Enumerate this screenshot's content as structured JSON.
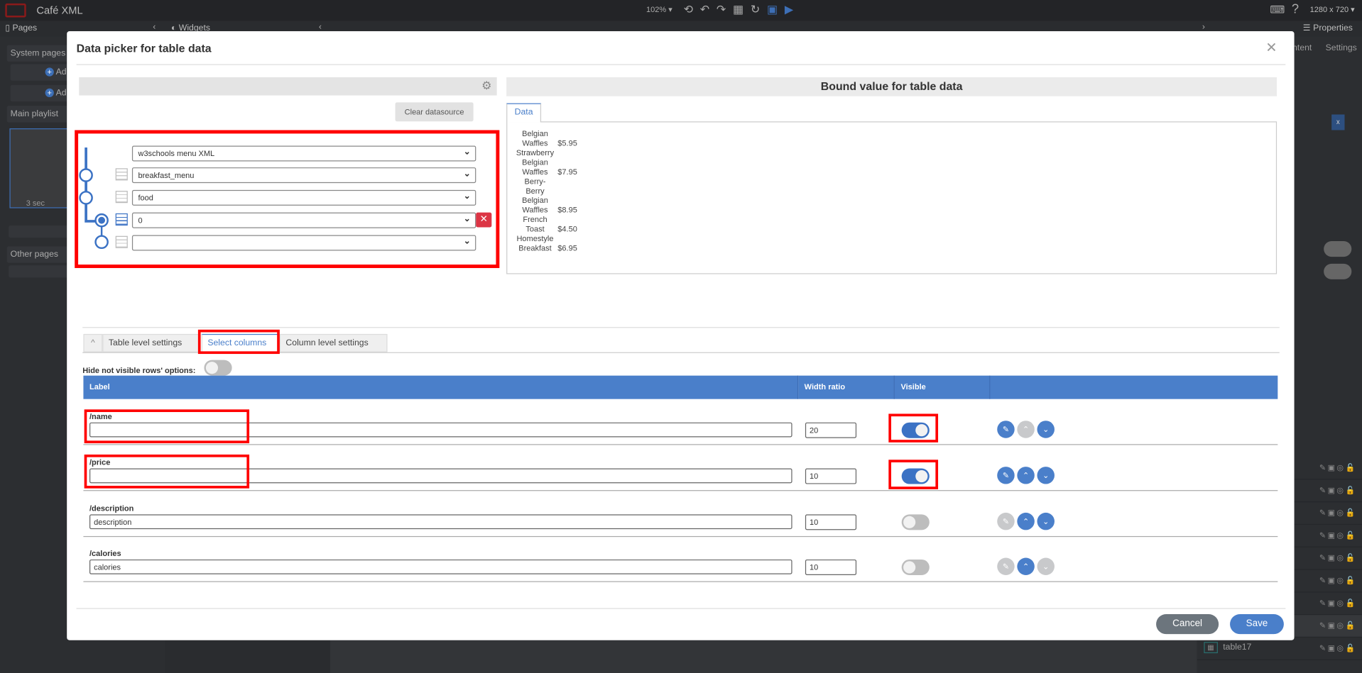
{
  "app": {
    "title": "Café XML",
    "zoom": "102%",
    "resolution": "1280 x 720"
  },
  "panels": {
    "pages": "Pages",
    "widgets": "Widgets",
    "properties": "Properties",
    "content_tab": "ntent",
    "settings_tab": "Settings"
  },
  "sidebar": {
    "system_pages": "System pages",
    "add1": "Ad",
    "add2": "Ad",
    "main_playlist": "Main playlist",
    "thumb_duration": "3 sec",
    "other_pages": "Other pages"
  },
  "layers": {
    "last_item": "table17"
  },
  "modal": {
    "title": "Data picker for table data",
    "clear_datasource": "Clear datasource",
    "selects": [
      "w3schools menu XML",
      "breakfast_menu",
      "food",
      "0",
      ""
    ],
    "bound_title": "Bound value for table data",
    "data_tab": "Data",
    "data_rows": [
      {
        "name": "Belgian Waffles",
        "price": "$5.95"
      },
      {
        "name": "Strawberry Belgian Waffles",
        "price": "$7.95"
      },
      {
        "name": "Berry-Berry Belgian Waffles",
        "price": "$8.95"
      },
      {
        "name": "French Toast",
        "price": "$4.50"
      },
      {
        "name": "Homestyle Breakfast",
        "price": "$6.95"
      }
    ],
    "tabs": [
      "Table level settings",
      "Select columns",
      "Column level settings"
    ],
    "active_tab": "Select columns",
    "hide_rows_label": "Hide not visible rows' options:",
    "hide_rows_on": false,
    "columns_header": {
      "label": "Label",
      "width_ratio": "Width ratio",
      "visible": "Visible"
    },
    "columns": [
      {
        "path": "/name",
        "label": "",
        "width_ratio": "20",
        "visible": true
      },
      {
        "path": "/price",
        "label": "",
        "width_ratio": "10",
        "visible": true
      },
      {
        "path": "/description",
        "label": "description",
        "width_ratio": "10",
        "visible": false
      },
      {
        "path": "/calories",
        "label": "calories",
        "width_ratio": "10",
        "visible": false
      }
    ],
    "cancel": "Cancel",
    "save": "Save"
  },
  "colors": {
    "accent": "#4a7fca",
    "highlight": "#ff0000",
    "danger": "#dc3545"
  }
}
